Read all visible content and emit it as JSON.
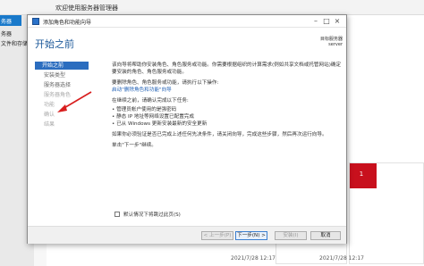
{
  "background": {
    "title": "欢迎使用服务器管理器",
    "left_items": [
      "务器",
      "务器",
      "文件和存储服务"
    ],
    "tile_badge": "1",
    "timestamps": [
      "2021/7/28 12:17",
      "2021/7/28 12:17"
    ]
  },
  "wizard": {
    "title": "添加角色和功能向导",
    "heading": "开始之前",
    "server_label": "目标服务器",
    "server_name": "server",
    "nav": [
      {
        "label": "开始之前",
        "state": "active"
      },
      {
        "label": "安装类型",
        "state": "normal"
      },
      {
        "label": "服务器选择",
        "state": "normal"
      },
      {
        "label": "服务器角色",
        "state": "dim"
      },
      {
        "label": "功能",
        "state": "dim"
      },
      {
        "label": "确认",
        "state": "dim"
      },
      {
        "label": "结果",
        "state": "dim"
      }
    ],
    "intro_line1": "该向导将帮助你安装角色、角色服务或功能。你需要根据组织的计算需求(例如共享文档或托管网站)确定",
    "intro_line2": "要安装的角色、角色服务或功能。",
    "remove_line": "要删除角色、角色服务或功能，请执行以下操作:",
    "remove_link": "启动\"删除角色和功能\"向导",
    "check_line": "在继续之前，请确认完成以下任务:",
    "tasks": [
      "• 管理员帐户使用的是强密码",
      "• 静态 IP 地址等网络设置已配置完成",
      "• 已从 Windows 更新安装最新的安全更新"
    ],
    "prereq_line": "如果你必须验证是否已完成上述任何先决条件，请关闭向导，完成这些步骤，然后再次运行向导。",
    "continue_line": "单击\"下一步\"继续。",
    "skip_label": "默认情况下将跳过此页(S)",
    "buttons": {
      "prev": "< 上一步(P)",
      "next": "下一步(N) >",
      "install": "安装(I)",
      "cancel": "取消"
    }
  },
  "colors": {
    "accent": "#2b6dbf",
    "heading": "#1e5a9a",
    "arrow": "#d81e1e",
    "tile_red": "#c8101d"
  }
}
